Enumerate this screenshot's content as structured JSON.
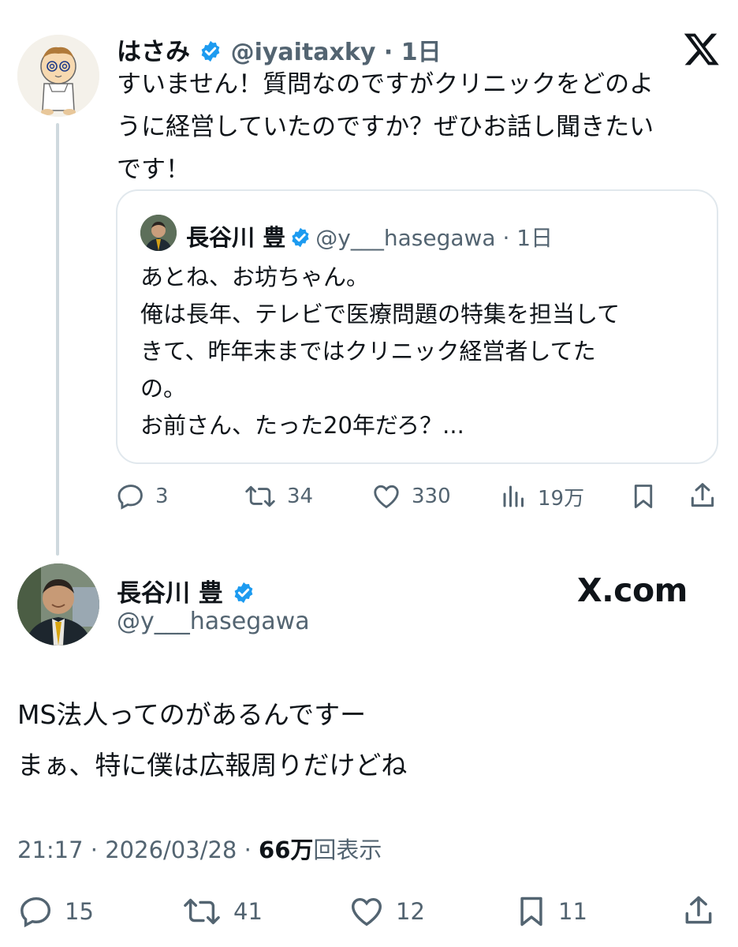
{
  "reply_tweet": {
    "author_name": "はさみ",
    "author_handle": "@iyaitaxky",
    "time_ago": "1日",
    "text": "すいません！質問なのですがクリニックをどのよ\nうに経営していたのですか？ぜひお話し聞きたい\nです！",
    "brand_icon": "x-logo-icon",
    "quoted_tweet": {
      "author_name": "長谷川 豊",
      "author_handle": "@y___hasegawa",
      "time_ago": "1日",
      "text": "あとね、お坊ちゃん。\n俺は長年、テレビで医療問題の特集を担当して\nきて、昨年末まではクリニック経営者してた\nの。\nお前さん、たった20年だろ？..."
    },
    "actions": {
      "replies": "3",
      "retweets": "34",
      "likes": "330",
      "views": "19万"
    }
  },
  "main_tweet": {
    "author_name": "長谷川 豊",
    "author_handle": "@y___hasegawa",
    "brand_text": "X.com",
    "text": "MS法人ってのがあるんですー\nまぁ、特に僕は広報周りだけどね",
    "time": "21:17",
    "date": "2026/03/28",
    "views_count": "66万",
    "views_label": "回表示",
    "actions": {
      "replies": "15",
      "retweets": "41",
      "likes": "12",
      "bookmarks": "11"
    }
  },
  "colors": {
    "verified": "#1d9bf0",
    "text": "#0f1419",
    "secondary": "#536471",
    "border": "#e1e8ed"
  }
}
